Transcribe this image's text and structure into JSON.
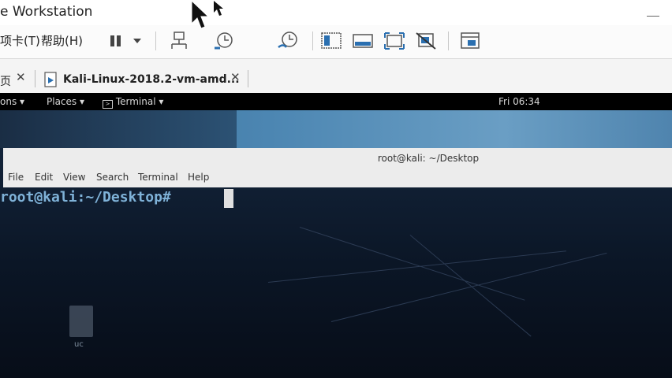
{
  "host": {
    "title": "e Workstation",
    "menu": [
      "选项卡(T)",
      "帮助(H)"
    ],
    "menu_display": [
      "项卡(T)",
      "帮助(H)"
    ],
    "tabs": [
      {
        "label": "页",
        "active": false
      },
      {
        "label": "Kali-Linux-2018.2-vm-amd...",
        "active": true
      }
    ]
  },
  "guest": {
    "topbar": {
      "applications": "ons",
      "places": "Places",
      "terminal": "Terminal",
      "clock": "Fri 06:34"
    },
    "terminal": {
      "title": "root@kali: ~/Desktop",
      "menu": [
        "File",
        "Edit",
        "View",
        "Search",
        "Terminal",
        "Help"
      ],
      "prompt": "root@kali:~/Desktop#",
      "prompt_display": "root@kali:~/Desktop#"
    },
    "desktop_file_label": "uc"
  },
  "colors": {
    "accent": "#2a6fb0",
    "prompt": "#7fb2d8",
    "terminal_bg": "#0b1626"
  }
}
